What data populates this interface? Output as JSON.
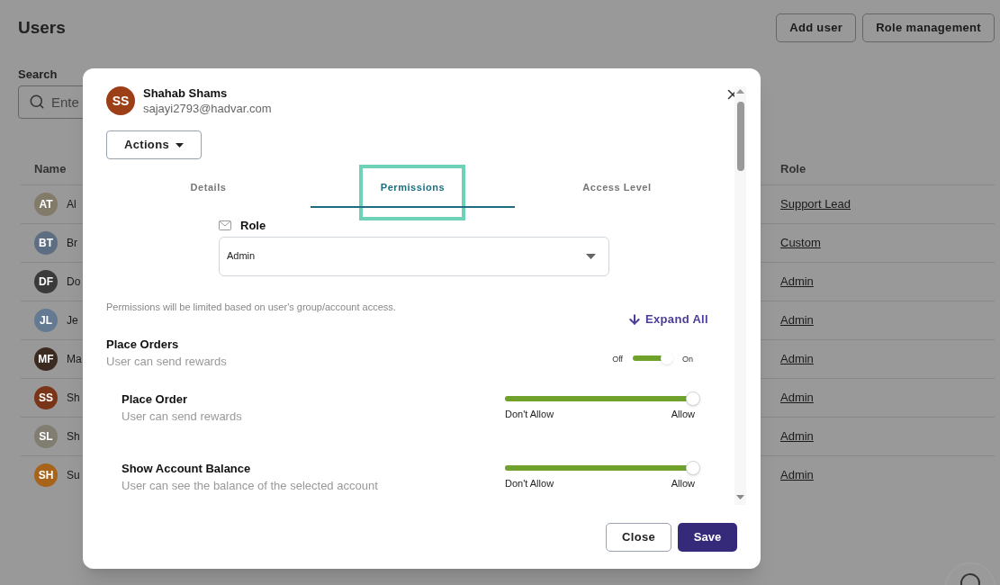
{
  "page": {
    "title": "Users",
    "buttons": [
      "Add user",
      "Role management"
    ],
    "search": {
      "label": "Search",
      "placeholder": "Ente"
    },
    "table": {
      "columns": [
        "Name",
        "Role"
      ],
      "rows": [
        {
          "initials": "AT",
          "name": "Al",
          "role": "Support Lead",
          "color": "#837b6a"
        },
        {
          "initials": "BT",
          "name": "Br",
          "role": "Custom",
          "color": "#5e6e82"
        },
        {
          "initials": "DF",
          "name": "Do",
          "role": "Admin",
          "color": "#3a3a3a"
        },
        {
          "initials": "JL",
          "name": "Je",
          "role": "Admin",
          "color": "#647a93"
        },
        {
          "initials": "MF",
          "name": "Ma",
          "role": "Admin",
          "color": "#3a2a20"
        },
        {
          "initials": "SS",
          "name": "Sh",
          "role": "Admin",
          "color": "#7a3518"
        },
        {
          "initials": "SL",
          "name": "Sh",
          "role": "Admin",
          "color": "#817d70"
        },
        {
          "initials": "SH",
          "name": "Su",
          "role": "Admin",
          "color": "#a8631a"
        }
      ]
    }
  },
  "modal": {
    "user": {
      "initials": "SS",
      "name": "Shahab Shams",
      "email": "sajayi2793@hadvar.com",
      "color": "#9c3f17"
    },
    "actions": "Actions",
    "tabs": [
      {
        "label": "Details",
        "selected": false
      },
      {
        "label": "Permissions",
        "selected": true
      },
      {
        "label": "Access Level",
        "selected": false
      }
    ],
    "role": {
      "label": "Role",
      "value": "Admin"
    },
    "note": "Permissions will be limited based on user's group/account access.",
    "expand_all": "Expand All",
    "permission_groups": [
      {
        "kind": "group",
        "title": "Place Orders",
        "description": "User can send rewards",
        "toggle": {
          "off_label": "Off",
          "on_label": "On",
          "on": true
        },
        "children": [
          {
            "kind": "item",
            "title": "Place Order",
            "description": "User can send rewards",
            "slider": {
              "level": 1,
              "min_label": "Don't Allow",
              "max_label": "Allow"
            }
          },
          {
            "kind": "item",
            "title": "Show Account Balance",
            "description": "User can see the balance of the selected account",
            "slider": {
              "level": 1,
              "min_label": "Don't Allow",
              "max_label": "Allow"
            }
          }
        ]
      }
    ],
    "buttons": {
      "close": "Close",
      "save": "Save"
    }
  }
}
